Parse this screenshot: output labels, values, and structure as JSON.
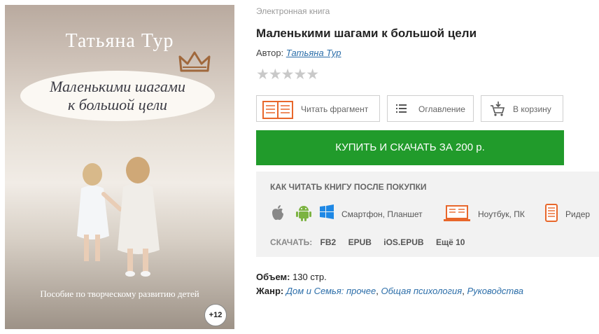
{
  "cover": {
    "author": "Татьяна Тур",
    "title_line1": "Маленькими шагами",
    "title_line2": "к большой цели",
    "subtitle": "Пособие по творческому развитию детей",
    "age_badge": "+12"
  },
  "book": {
    "type_label": "Электронная книга",
    "title": "Маленькими шагами к большой цели",
    "author_label": "Автор:",
    "author_name": "Татьяна Тур",
    "rating_stars": "★★★★★",
    "rating_value": 0
  },
  "actions": {
    "read_fragment": "Читать фрагмент",
    "contents": "Оглавление",
    "to_cart": "В корзину",
    "buy": "КУПИТЬ И СКАЧАТЬ ЗА 200 р."
  },
  "howto": {
    "title": "КАК ЧИТАТЬ КНИГУ ПОСЛЕ ПОКУПКИ",
    "smartphone": "Смартфон, Планшет",
    "laptop": "Ноутбук, ПК",
    "reader": "Ридер",
    "download_label": "СКАЧАТЬ:",
    "formats": [
      "FB2",
      "EPUB",
      "iOS.EPUB",
      "Ещё 10"
    ]
  },
  "meta": {
    "volume_label": "Объем:",
    "volume_value": "130 стр.",
    "genre_label": "Жанр:",
    "genres": [
      "Дом и Семья: прочее",
      "Общая психология",
      "Руководства"
    ]
  },
  "colors": {
    "buy_green": "#219b2b",
    "link_blue": "#2c6ea9",
    "accent_orange": "#e8672b"
  }
}
